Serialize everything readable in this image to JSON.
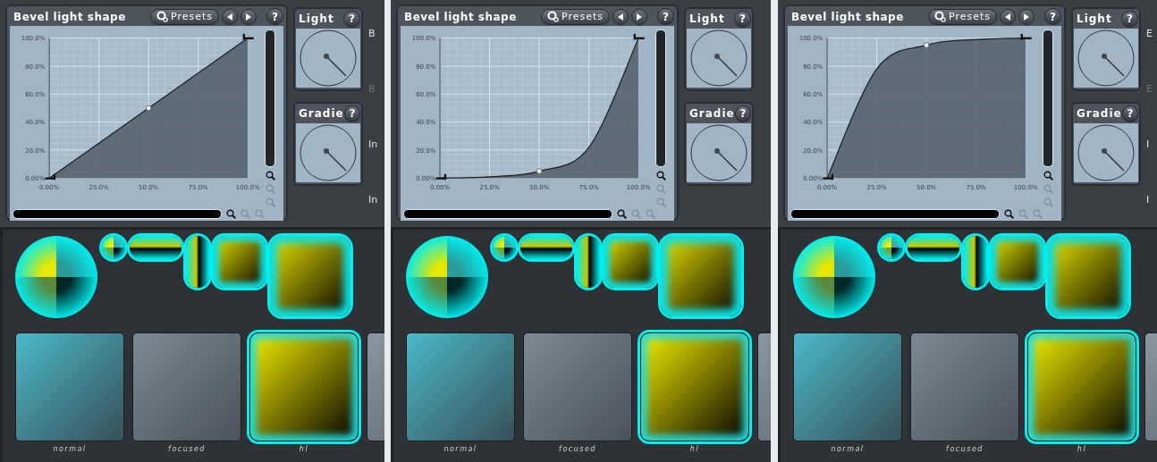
{
  "panels": [
    {
      "editor": {
        "title": "Bevel light shape",
        "presets_label": "Presets",
        "help": "?",
        "chart_data": {
          "type": "area",
          "x": [
            0,
            25,
            50,
            75,
            100
          ],
          "grid": true,
          "series": [
            {
              "color": "#1a1f24",
              "values": [
                0,
                25,
                50,
                75,
                100
              ]
            }
          ],
          "xlim": [
            0,
            100
          ],
          "ylim": [
            0,
            100
          ],
          "xticks": [
            {
              "value": 0,
              "label": "0.00%"
            },
            {
              "value": 25,
              "label": "25.0%"
            },
            {
              "value": 50,
              "label": "50.0%"
            },
            {
              "value": 75,
              "label": "75.0%"
            },
            {
              "value": 100,
              "label": "100.0%"
            }
          ],
          "yticks": [
            {
              "value": 0,
              "label": "0.00%"
            },
            {
              "value": 20,
              "label": "20.0%"
            },
            {
              "value": 40,
              "label": "40.0%"
            },
            {
              "value": 60,
              "label": "60.0%"
            },
            {
              "value": 80,
              "label": "80.0%"
            },
            {
              "value": 100,
              "label": "100.0%"
            }
          ]
        },
        "zoom_buttons": [
          {
            "disabled": false
          },
          {
            "disabled": true
          },
          {
            "disabled": true
          }
        ]
      },
      "knobs": [
        {
          "title": "Light",
          "help": "?"
        },
        {
          "title": "Gradie",
          "help": "?"
        }
      ],
      "edge_labels": [
        {
          "text": "B",
          "disabled": false
        },
        {
          "text": "B",
          "disabled": true
        },
        {
          "text": "In",
          "disabled": false
        },
        {
          "text": "In",
          "disabled": false
        }
      ],
      "tiles": [
        {
          "kind": "normal",
          "label": "normal"
        },
        {
          "kind": "focused",
          "label": "focused"
        },
        {
          "kind": "hl",
          "label": "hl"
        },
        {
          "kind": "plain"
        }
      ]
    },
    {
      "editor": {
        "title": "Bevel light shape",
        "presets_label": "Presets",
        "help": "?",
        "chart_data": {
          "type": "area",
          "x": [
            0,
            25,
            50,
            75,
            100
          ],
          "grid": true,
          "series": [
            {
              "color": "#1a1f24",
              "values": [
                0,
                1,
                5,
                22,
                100
              ]
            }
          ],
          "xlim": [
            0,
            100
          ],
          "ylim": [
            0,
            100
          ],
          "xticks": [
            {
              "value": 0,
              "label": "0.00%"
            },
            {
              "value": 25,
              "label": "25.0%"
            },
            {
              "value": 50,
              "label": "50.0%"
            },
            {
              "value": 75,
              "label": "75.0%"
            },
            {
              "value": 100,
              "label": "100.0%"
            }
          ],
          "yticks": [
            {
              "value": 0,
              "label": "0.00%"
            },
            {
              "value": 20,
              "label": "20.0%"
            },
            {
              "value": 40,
              "label": "40.0%"
            },
            {
              "value": 60,
              "label": "60.0%"
            },
            {
              "value": 80,
              "label": "80.0%"
            },
            {
              "value": 100,
              "label": "100.0%"
            }
          ]
        },
        "zoom_buttons": [
          {
            "disabled": false
          },
          {
            "disabled": true
          },
          {
            "disabled": true
          }
        ]
      },
      "knobs": [
        {
          "title": "Light",
          "help": "?"
        },
        {
          "title": "Gradie",
          "help": "?"
        }
      ],
      "tiles": [
        {
          "kind": "normal",
          "label": "normal"
        },
        {
          "kind": "focused",
          "label": "focused"
        },
        {
          "kind": "hl",
          "label": "hl"
        },
        {
          "kind": "plain"
        }
      ]
    },
    {
      "editor": {
        "title": "Bevel light shape",
        "presets_label": "Presets",
        "help": "?",
        "chart_data": {
          "type": "area",
          "x": [
            0,
            25,
            50,
            75,
            100
          ],
          "grid": true,
          "series": [
            {
              "color": "#1a1f24",
              "values": [
                0,
                78,
                95,
                99,
                100
              ]
            }
          ],
          "xlim": [
            0,
            100
          ],
          "ylim": [
            0,
            100
          ],
          "xticks": [
            {
              "value": 0,
              "label": "0.00%"
            },
            {
              "value": 25,
              "label": "25.0%"
            },
            {
              "value": 50,
              "label": "50.0%"
            },
            {
              "value": 75,
              "label": "75.0%"
            },
            {
              "value": 100,
              "label": "100.0%"
            }
          ],
          "yticks": [
            {
              "value": 0,
              "label": "0.00%"
            },
            {
              "value": 20,
              "label": "20.0%"
            },
            {
              "value": 40,
              "label": "40.0%"
            },
            {
              "value": 60,
              "label": "60.0%"
            },
            {
              "value": 80,
              "label": "80.0%"
            },
            {
              "value": 100,
              "label": "100.0%"
            }
          ]
        },
        "zoom_buttons": [
          {
            "disabled": false
          },
          {
            "disabled": true
          },
          {
            "disabled": true
          }
        ]
      },
      "knobs": [
        {
          "title": "Light",
          "help": "?"
        },
        {
          "title": "Gradie",
          "help": "?"
        }
      ],
      "edge_labels": [
        {
          "text": "E",
          "disabled": false
        },
        {
          "text": "E",
          "disabled": true
        },
        {
          "text": "I",
          "disabled": false
        },
        {
          "text": "I",
          "disabled": false
        }
      ],
      "tiles": [
        {
          "kind": "normal",
          "label": "normal"
        },
        {
          "kind": "focused",
          "label": "focused"
        },
        {
          "kind": "hl",
          "label": "hl"
        },
        {
          "kind": "plain"
        }
      ]
    }
  ]
}
